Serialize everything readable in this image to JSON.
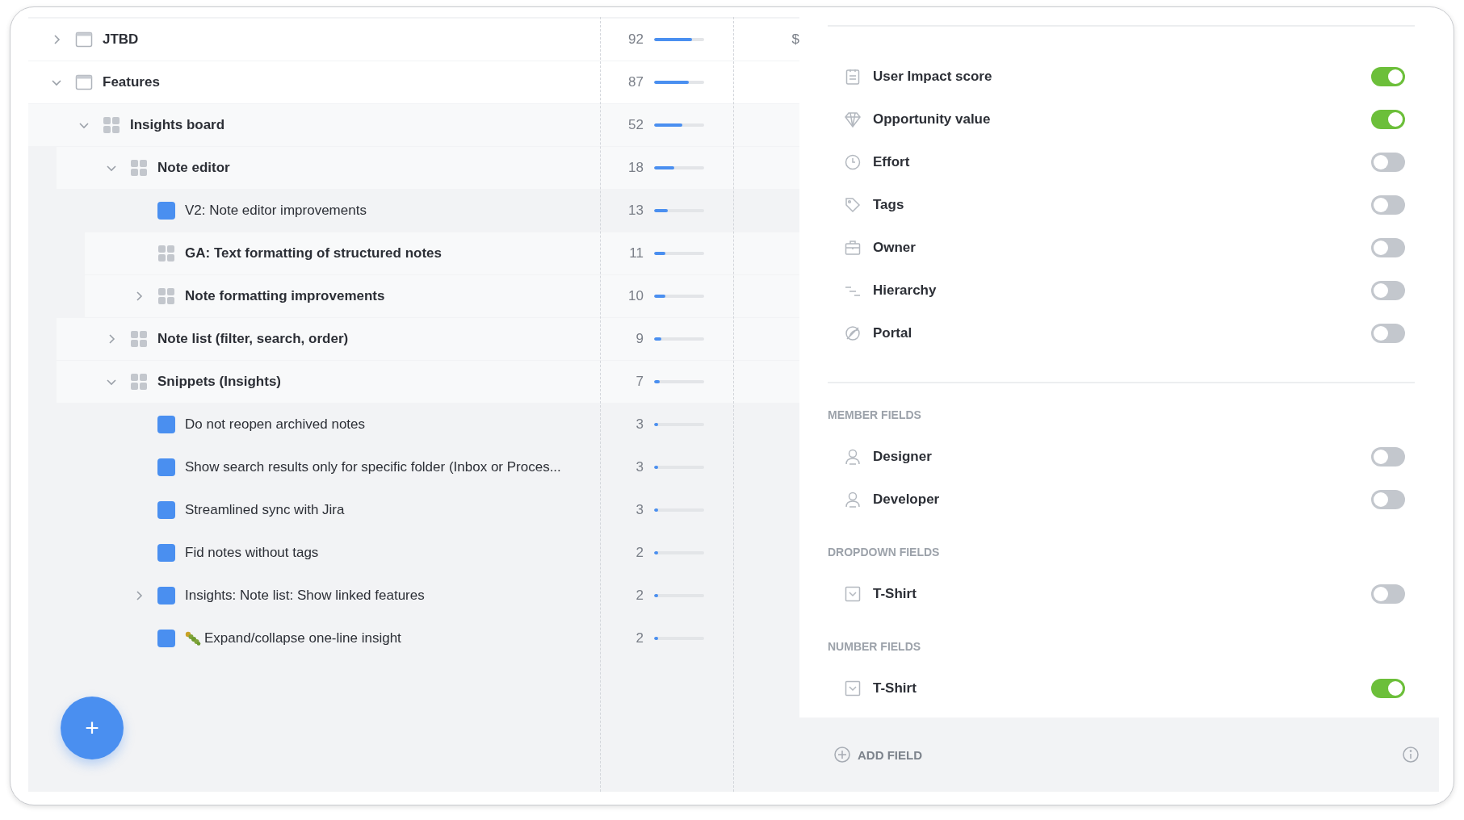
{
  "tree": [
    {
      "label": "JTBD",
      "kind": "folder",
      "score": "92",
      "level": 0.75,
      "column_3": "$",
      "expanded": false
    },
    {
      "label": "Features",
      "kind": "folder",
      "score": "87",
      "level": 0.7,
      "expanded": true,
      "children": [
        {
          "label": "Insights board",
          "kind": "board",
          "score": "52",
          "level": 0.57,
          "expanded": true,
          "children": [
            {
              "label": "Note editor",
              "kind": "board",
              "score": "18",
              "level": 0.4,
              "expanded": true,
              "children": [
                {
                  "label": "V2: Note editor improvements",
                  "kind": "feature",
                  "score": "13",
                  "level": 0.28
                },
                {
                  "label": "GA: Text formatting of structured notes",
                  "kind": "board",
                  "score": "11",
                  "level": 0.22
                },
                {
                  "label": "Note formatting improvements",
                  "kind": "board",
                  "score": "10",
                  "level": 0.22,
                  "expanded": false
                }
              ]
            },
            {
              "label": "Note list (filter, search, order)",
              "kind": "board",
              "score": "9",
              "level": 0.15,
              "expanded": false
            },
            {
              "label": "Snippets (Insights)",
              "kind": "board",
              "score": "7",
              "level": 0.12,
              "expanded": true,
              "children": [
                {
                  "label": "Do not reopen archived notes",
                  "kind": "feature",
                  "score": "3",
                  "level": 0.06
                },
                {
                  "label": "Show search results only for specific folder (Inbox or Proces...",
                  "kind": "feature",
                  "score": "3",
                  "level": 0.06
                },
                {
                  "label": "Streamlined sync with Jira",
                  "kind": "feature",
                  "score": "3",
                  "level": 0.06
                },
                {
                  "label": "Fid notes without tags",
                  "kind": "feature",
                  "score": "2",
                  "level": 0.06
                },
                {
                  "label": "Insights: Note list: Show linked features",
                  "kind": "feature",
                  "score": "2",
                  "level": 0.06,
                  "expanded": false
                },
                {
                  "label": "Expand/collapse one-line insight",
                  "kind": "feature",
                  "score": "2",
                  "level": 0.06,
                  "emoji": true
                }
              ]
            }
          ]
        }
      ]
    }
  ],
  "fab": {
    "label": "+"
  },
  "field_groups": [
    {
      "fields": [
        {
          "label": "User Impact score",
          "on": true
        },
        {
          "label": "Opportunity value",
          "on": true
        },
        {
          "label": "Effort",
          "on": false
        },
        {
          "label": "Tags",
          "on": false
        },
        {
          "label": "Owner",
          "on": false
        },
        {
          "label": "Hierarchy",
          "on": false
        },
        {
          "label": "Portal",
          "on": false
        }
      ]
    },
    {
      "heading": "MEMBER FIELDS",
      "fields": [
        {
          "label": "Designer",
          "on": false
        },
        {
          "label": "Developer",
          "on": false
        }
      ]
    },
    {
      "heading": "DROPDOWN FIELDS",
      "fields": [
        {
          "label": "T-Shirt",
          "on": false
        }
      ]
    },
    {
      "heading": "NUMBER FIELDS",
      "fields": [
        {
          "label": "T-Shirt",
          "on": true
        }
      ]
    }
  ],
  "footer": {
    "add_button": "ADD FIELD"
  }
}
